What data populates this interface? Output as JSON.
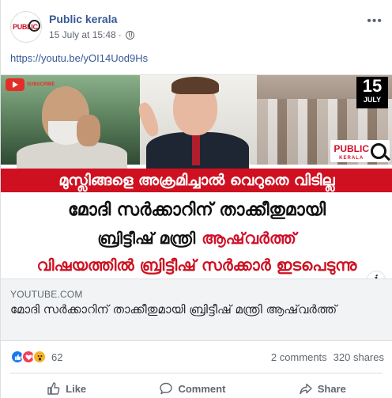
{
  "post": {
    "page_name": "Public kerala",
    "timestamp": "15 July at 15:48",
    "audience_icon": "globe-icon",
    "more_icon": "more-options-icon",
    "text": "https://youtu.be/yOI14Uod9Hs",
    "avatar": {
      "logo_text": "PUBLIC"
    }
  },
  "link_preview": {
    "thumbnail": {
      "subscribe_text": "SUBSCRIBE",
      "date_day": "15",
      "date_month": "JULY",
      "brand_main": "PUBLIC",
      "brand_sub": "KERALA",
      "banner_red": "മുസ്ലിങ്ങളെ അക്രമിച്ചാൽ വെറുതെ വിടില്ല",
      "line_black": "മോദി സർക്കാറിന് താക്കീതുമായി",
      "line_mixed_a": "ബ്രിട്ടീഷ് മന്ത്രി",
      "line_mixed_b": "ആഷ്‌വർത്ത്",
      "line_red": "വിഷയത്തിൽ ബ്രിട്ടീഷ് സർക്കാർ ഇടപെടുന്നു"
    },
    "domain": "YOUTUBE.COM",
    "title": "മോദി സർക്കാറിന് താക്കീതുമായി ബ്രിട്ടീഷ് മന്ത്രി ആഷ്‌വർത്ത്",
    "info_icon": "info-icon"
  },
  "engagement": {
    "reaction_icons": [
      "like-reaction-icon",
      "love-reaction-icon",
      "wow-reaction-icon"
    ],
    "reaction_count": "62",
    "comments": "2 comments",
    "shares": "320 shares"
  },
  "actions": {
    "like": "Like",
    "comment": "Comment",
    "share": "Share"
  },
  "colors": {
    "link": "#385898",
    "accent_red": "#cf1020",
    "like_blue": "#1877f2"
  }
}
